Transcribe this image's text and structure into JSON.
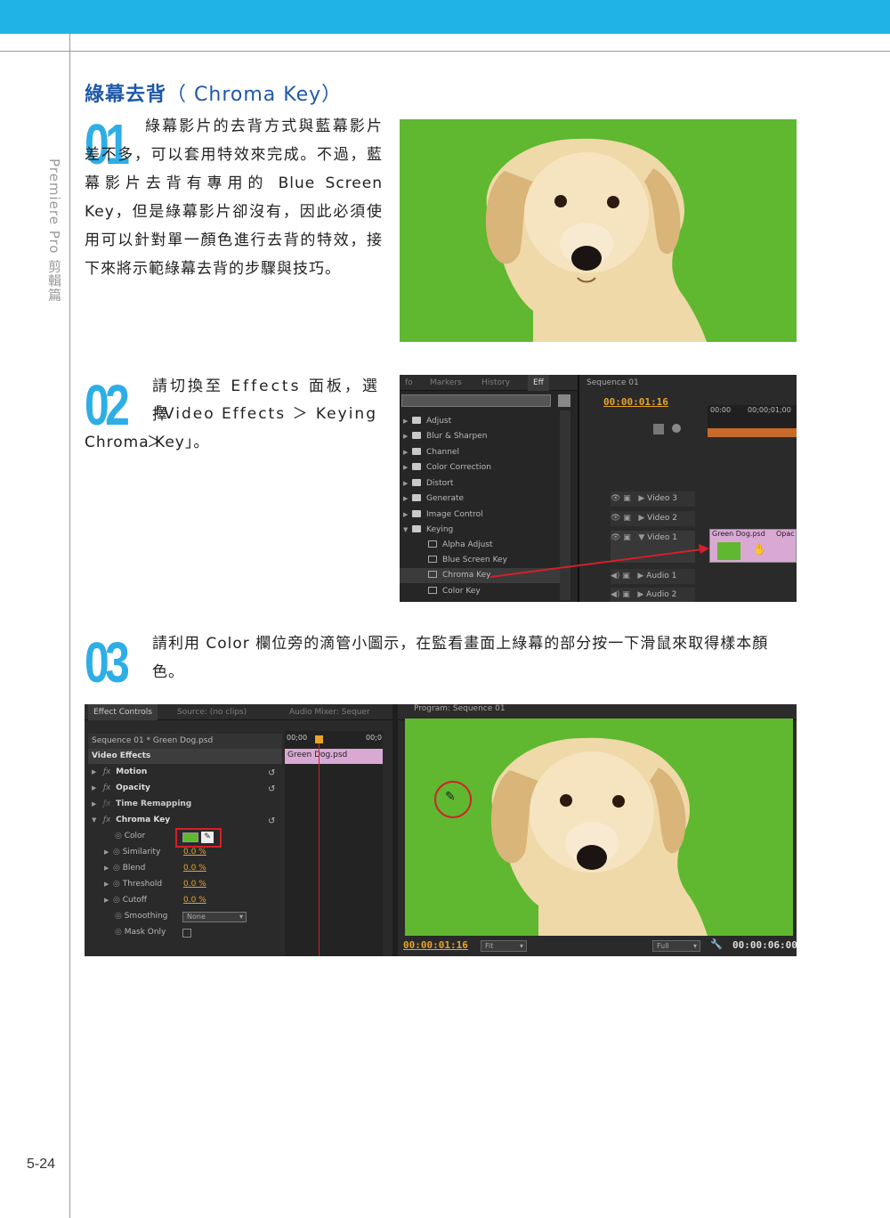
{
  "side_title": "Premiere Pro 剪輯篇",
  "page_number": "5-24",
  "heading": {
    "zh": "綠幕去背",
    "en": "（ Chroma Key）"
  },
  "steps": [
    {
      "num": "01",
      "text": "綠幕影片的去背方式與藍幕影片差不多，可以套用特效來完成。不過，藍幕影片去背有專用的 Blue Screen Key，但是綠幕影片卻沒有，因此必須使用可以針對單一顏色進行去背的特效，接下來將示範綠幕去背的步驟與技巧。"
    },
    {
      "num": "02",
      "text_a": "請切換至 Effects 面板，選擇",
      "text_b": "「Video Effects ＞ Keying ＞",
      "text_c": "Chroma Key」。"
    },
    {
      "num": "03",
      "text": "請利用 Color 欄位旁的滴管小圖示，在監看畫面上綠幕的部分按一下滑鼠來取得樣本顏色。"
    }
  ],
  "colors": {
    "accent": "#1fb3e6",
    "heading": "#1f58a8",
    "green_screen": "#5fb82f",
    "highlight_red": "#d3202a",
    "timecode": "#e8a32a"
  },
  "effects_panel": {
    "tabs": [
      "fo",
      "Markers",
      "History",
      "Eff"
    ],
    "items": [
      {
        "label": "Adjust",
        "type": "folder"
      },
      {
        "label": "Blur & Sharpen",
        "type": "folder"
      },
      {
        "label": "Channel",
        "type": "folder"
      },
      {
        "label": "Color Correction",
        "type": "folder"
      },
      {
        "label": "Distort",
        "type": "folder"
      },
      {
        "label": "Generate",
        "type": "folder"
      },
      {
        "label": "Image Control",
        "type": "folder"
      },
      {
        "label": "Keying",
        "type": "folder-open"
      },
      {
        "label": "Alpha Adjust",
        "type": "effect"
      },
      {
        "label": "Blue Screen Key",
        "type": "effect"
      },
      {
        "label": "Chroma Key",
        "type": "effect-selected"
      },
      {
        "label": "Color Key",
        "type": "effect"
      }
    ]
  },
  "sequence_panel": {
    "tab": "Sequence 01",
    "timecode": "00:00:01:16",
    "ruler": [
      "00:00",
      "00;00;01;00"
    ],
    "tracks": [
      "Video 3",
      "Video 2",
      "Video 1",
      "Audio 1",
      "Audio 2"
    ],
    "clip_label": "Green Dog.psd",
    "clip_opacity": "Opac"
  },
  "effect_controls": {
    "tabs": [
      "Effect Controls",
      "Source: (no clips)",
      "Audio Mixer: Sequer"
    ],
    "sequence": "Sequence 01 * Green Dog.psd",
    "ruler_start": "00;00",
    "ruler_end": "00;0",
    "clip_label": "Green Dog.psd",
    "section": "Video Effects",
    "effects": [
      "Motion",
      "Opacity",
      "Time Remapping",
      "Chroma Key"
    ],
    "params": [
      {
        "label": "Color"
      },
      {
        "label": "Similarity",
        "value": "0.0 %"
      },
      {
        "label": "Blend",
        "value": "0.0 %"
      },
      {
        "label": "Threshold",
        "value": "0.0 %"
      },
      {
        "label": "Cutoff",
        "value": "0.0 %"
      },
      {
        "label": "Smoothing",
        "value": "None"
      },
      {
        "label": "Mask Only"
      }
    ]
  },
  "program_monitor": {
    "tab": "Program: Sequence 01",
    "timecode_left": "00:00:01:16",
    "fit": "Fit",
    "quality": "Full",
    "timecode_right": "00:00:06:00"
  }
}
